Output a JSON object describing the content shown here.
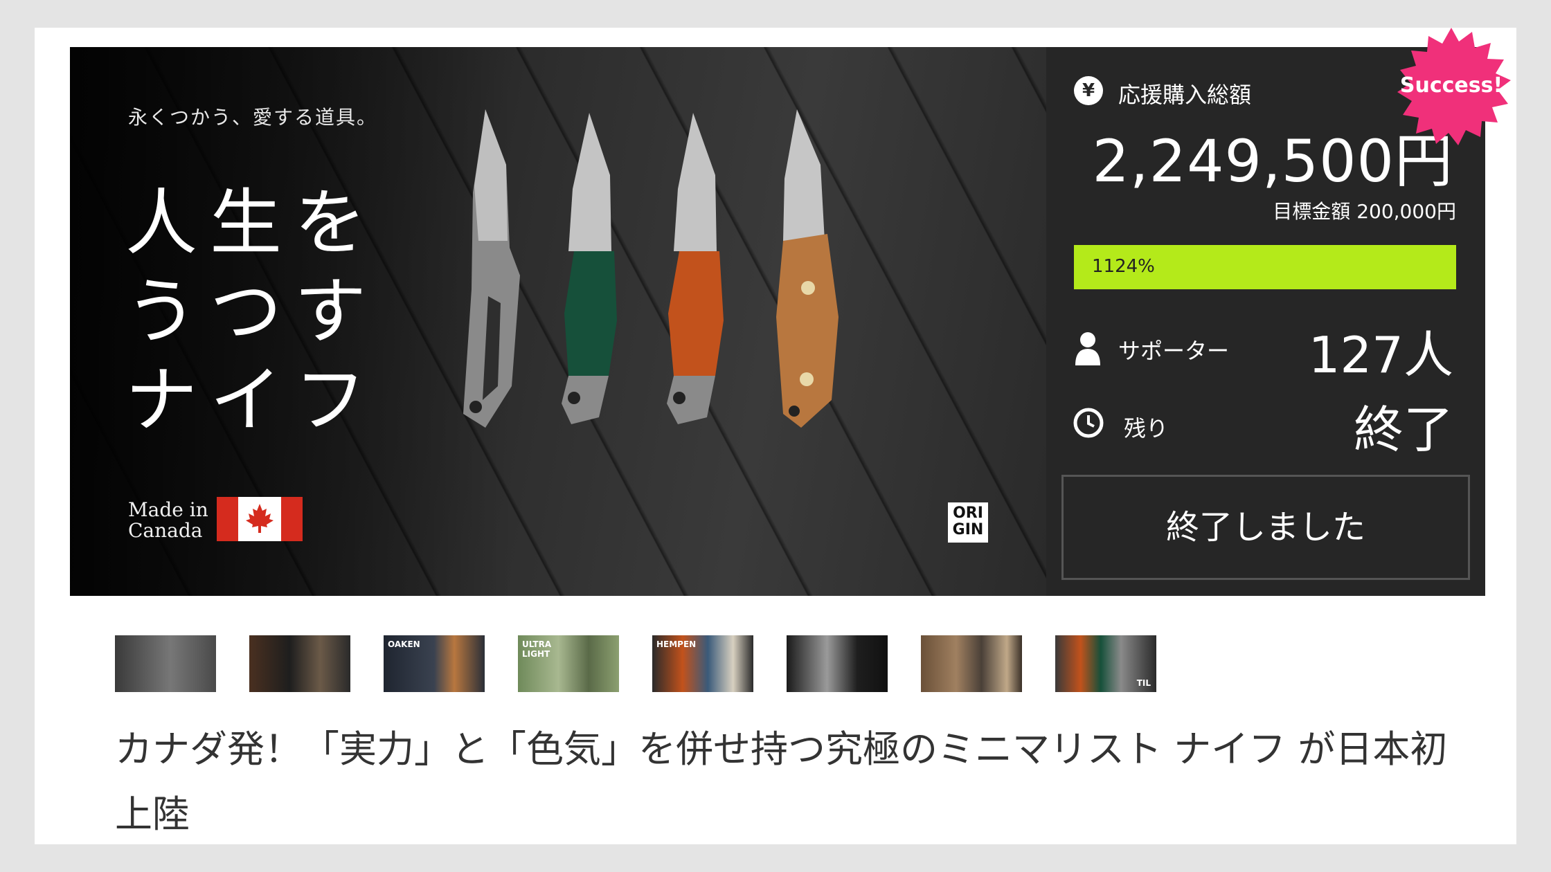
{
  "hero": {
    "tagline": "永くつかう、愛する道具。",
    "title": "人生をうつすナイフ",
    "made_in": "Made in\nCanada",
    "brand_logo": "ORI\nGIN"
  },
  "badge": {
    "text": "Success!",
    "color": "#f0307a"
  },
  "stats": {
    "total_label": "応援購入総額",
    "total_amount": "2,249,500円",
    "goal_text": "目標金額 200,000円",
    "progress_percent": 1124,
    "progress_text": "1124%",
    "progress_color": "#b4ea1a",
    "supporters_label": "サポーター",
    "supporters_value": "127人",
    "remaining_label": "残り",
    "remaining_value": "終了",
    "ended_button": "終了しました"
  },
  "icons": {
    "yen": "¥",
    "person": "person-icon",
    "clock": "clock-icon"
  },
  "thumbnails": [
    {
      "caption": ""
    },
    {
      "caption": ""
    },
    {
      "caption": "OAKEN"
    },
    {
      "caption": "ULTRA\nLIGHT"
    },
    {
      "caption": "HEMPEN"
    },
    {
      "caption": ""
    },
    {
      "caption": ""
    },
    {
      "caption": "TIL"
    }
  ],
  "page_title": "カナダ発！「実力」と「色気」を併せ持つ究極のミニマリスト ナイフ が日本初上陸"
}
